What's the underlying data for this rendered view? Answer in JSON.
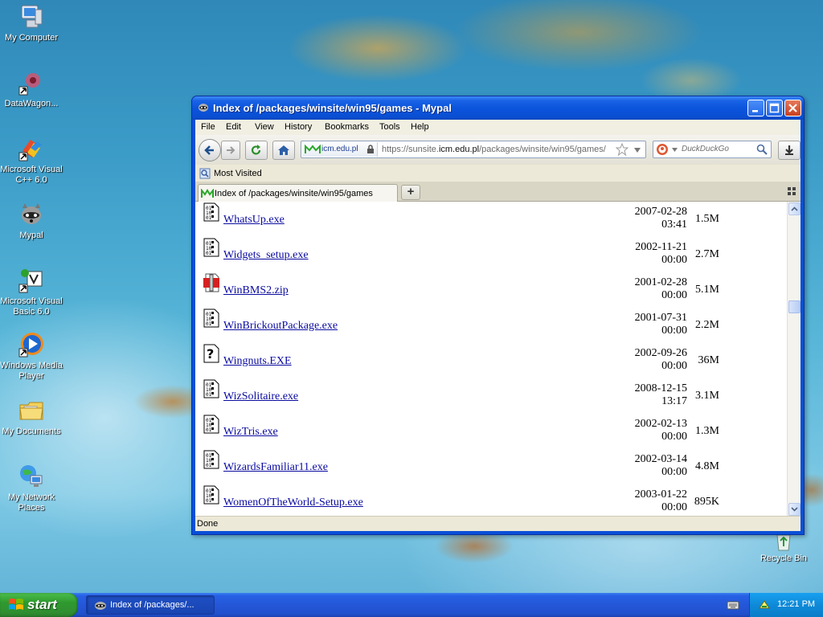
{
  "desktop": {
    "icons": [
      {
        "label": "My Computer"
      },
      {
        "label": "DataWagon..."
      },
      {
        "label": "Microsoft Visual C++ 6.0"
      },
      {
        "label": "Mypal"
      },
      {
        "label": "Microsoft Visual Basic 6.0"
      },
      {
        "label": "Windows Media Player"
      },
      {
        "label": "My Documents"
      },
      {
        "label": "My Network Places"
      },
      {
        "label": "Recycle Bin"
      }
    ]
  },
  "window": {
    "title": "Index of /packages/winsite/win95/games - Mypal",
    "menu": [
      "File",
      "Edit",
      "View",
      "History",
      "Bookmarks",
      "Tools",
      "Help"
    ],
    "nav": {
      "identity_domain": "icm.edu.pl",
      "url_prefix": "https://sunsite.",
      "url_host": "icm.edu.pl",
      "url_path": "/packages/winsite/win95/games/",
      "search_placeholder": "DuckDuckGo"
    },
    "bookmarks": {
      "most_visited": "Most Visited"
    },
    "tab": {
      "title": "Index of /packages/winsite/win95/games",
      "new_tab": "+"
    },
    "status": "Done"
  },
  "listing": [
    {
      "name": "WhatsUp.exe",
      "date": "2007-02-28\n03:41",
      "size": "1.5M",
      "icon": "binary-file-icon"
    },
    {
      "name": "Widgets_setup.exe",
      "date": "2002-11-21\n00:00",
      "size": "2.7M",
      "icon": "binary-file-icon"
    },
    {
      "name": "WinBMS2.zip",
      "date": "2001-02-28\n00:00",
      "size": "5.1M",
      "icon": "compressed-file-icon"
    },
    {
      "name": "WinBrickoutPackage.exe",
      "date": "2001-07-31\n00:00",
      "size": "2.2M",
      "icon": "binary-file-icon"
    },
    {
      "name": "Wingnuts.EXE",
      "date": "2002-09-26\n00:00",
      "size": "36M",
      "icon": "unknown-file-icon"
    },
    {
      "name": "WizSolitaire.exe",
      "date": "2008-12-15\n13:17",
      "size": "3.1M",
      "icon": "binary-file-icon"
    },
    {
      "name": "WizTris.exe",
      "date": "2002-02-13\n00:00",
      "size": "1.3M",
      "icon": "binary-file-icon"
    },
    {
      "name": "WizardsFamiliar11.exe",
      "date": "2002-03-14\n00:00",
      "size": "4.8M",
      "icon": "binary-file-icon"
    },
    {
      "name": "WomenOfTheWorld-Setup.exe",
      "date": "2003-01-22\n00:00",
      "size": "895K",
      "icon": "binary-file-icon"
    }
  ],
  "taskbar": {
    "start_label": "start",
    "task_label": "Index of /packages/...",
    "clock": "12:21 PM"
  }
}
